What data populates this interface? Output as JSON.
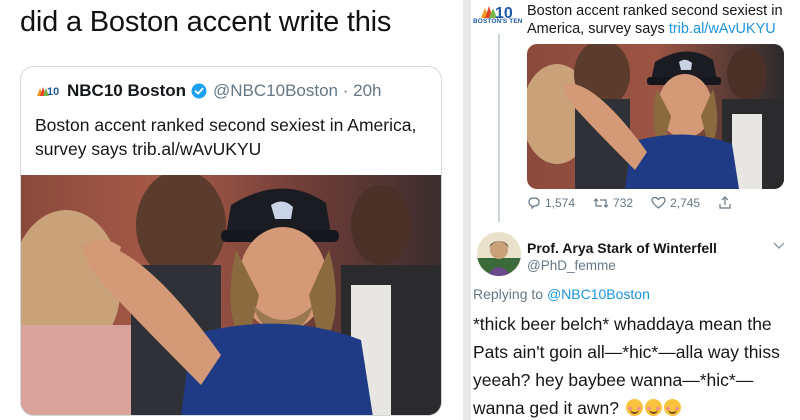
{
  "left": {
    "caption": "did a Boston accent write this",
    "quote_card": {
      "account_name": "NBC10 Boston",
      "handle_time": "@NBC10Boston · 20h",
      "text": "Boston accent ranked second sexiest in America, survey says trib.al/wAvUKYU",
      "logo_icon": "nbc10-logo",
      "verified_icon": "verified-badge-icon"
    }
  },
  "right": {
    "logo_caption": "BOSTON'S TEN",
    "tweet_text_plain": "Boston accent ranked second sexiest in America, survey says",
    "tweet_link": "trib.al/wAvUKYU",
    "actions": {
      "replies": "1,574",
      "retweets": "732",
      "likes": "2,745"
    },
    "reply": {
      "name": "Prof. Arya Stark of Winterfell",
      "handle": "@PhD_femme",
      "replying_prefix": "Replying to",
      "replying_to": "@NBC10Boston",
      "body": "*thick beer belch* whaddaya mean the Pats ain't goin all—*hic*—alla way thiss yeeah? hey baybee wanna—*hic*—wanna ged it awn?"
    }
  },
  "colors": {
    "link": "#1b95e0",
    "verified": "#1da1f2",
    "muted": "#657786",
    "divider": "#e8e8e8"
  }
}
